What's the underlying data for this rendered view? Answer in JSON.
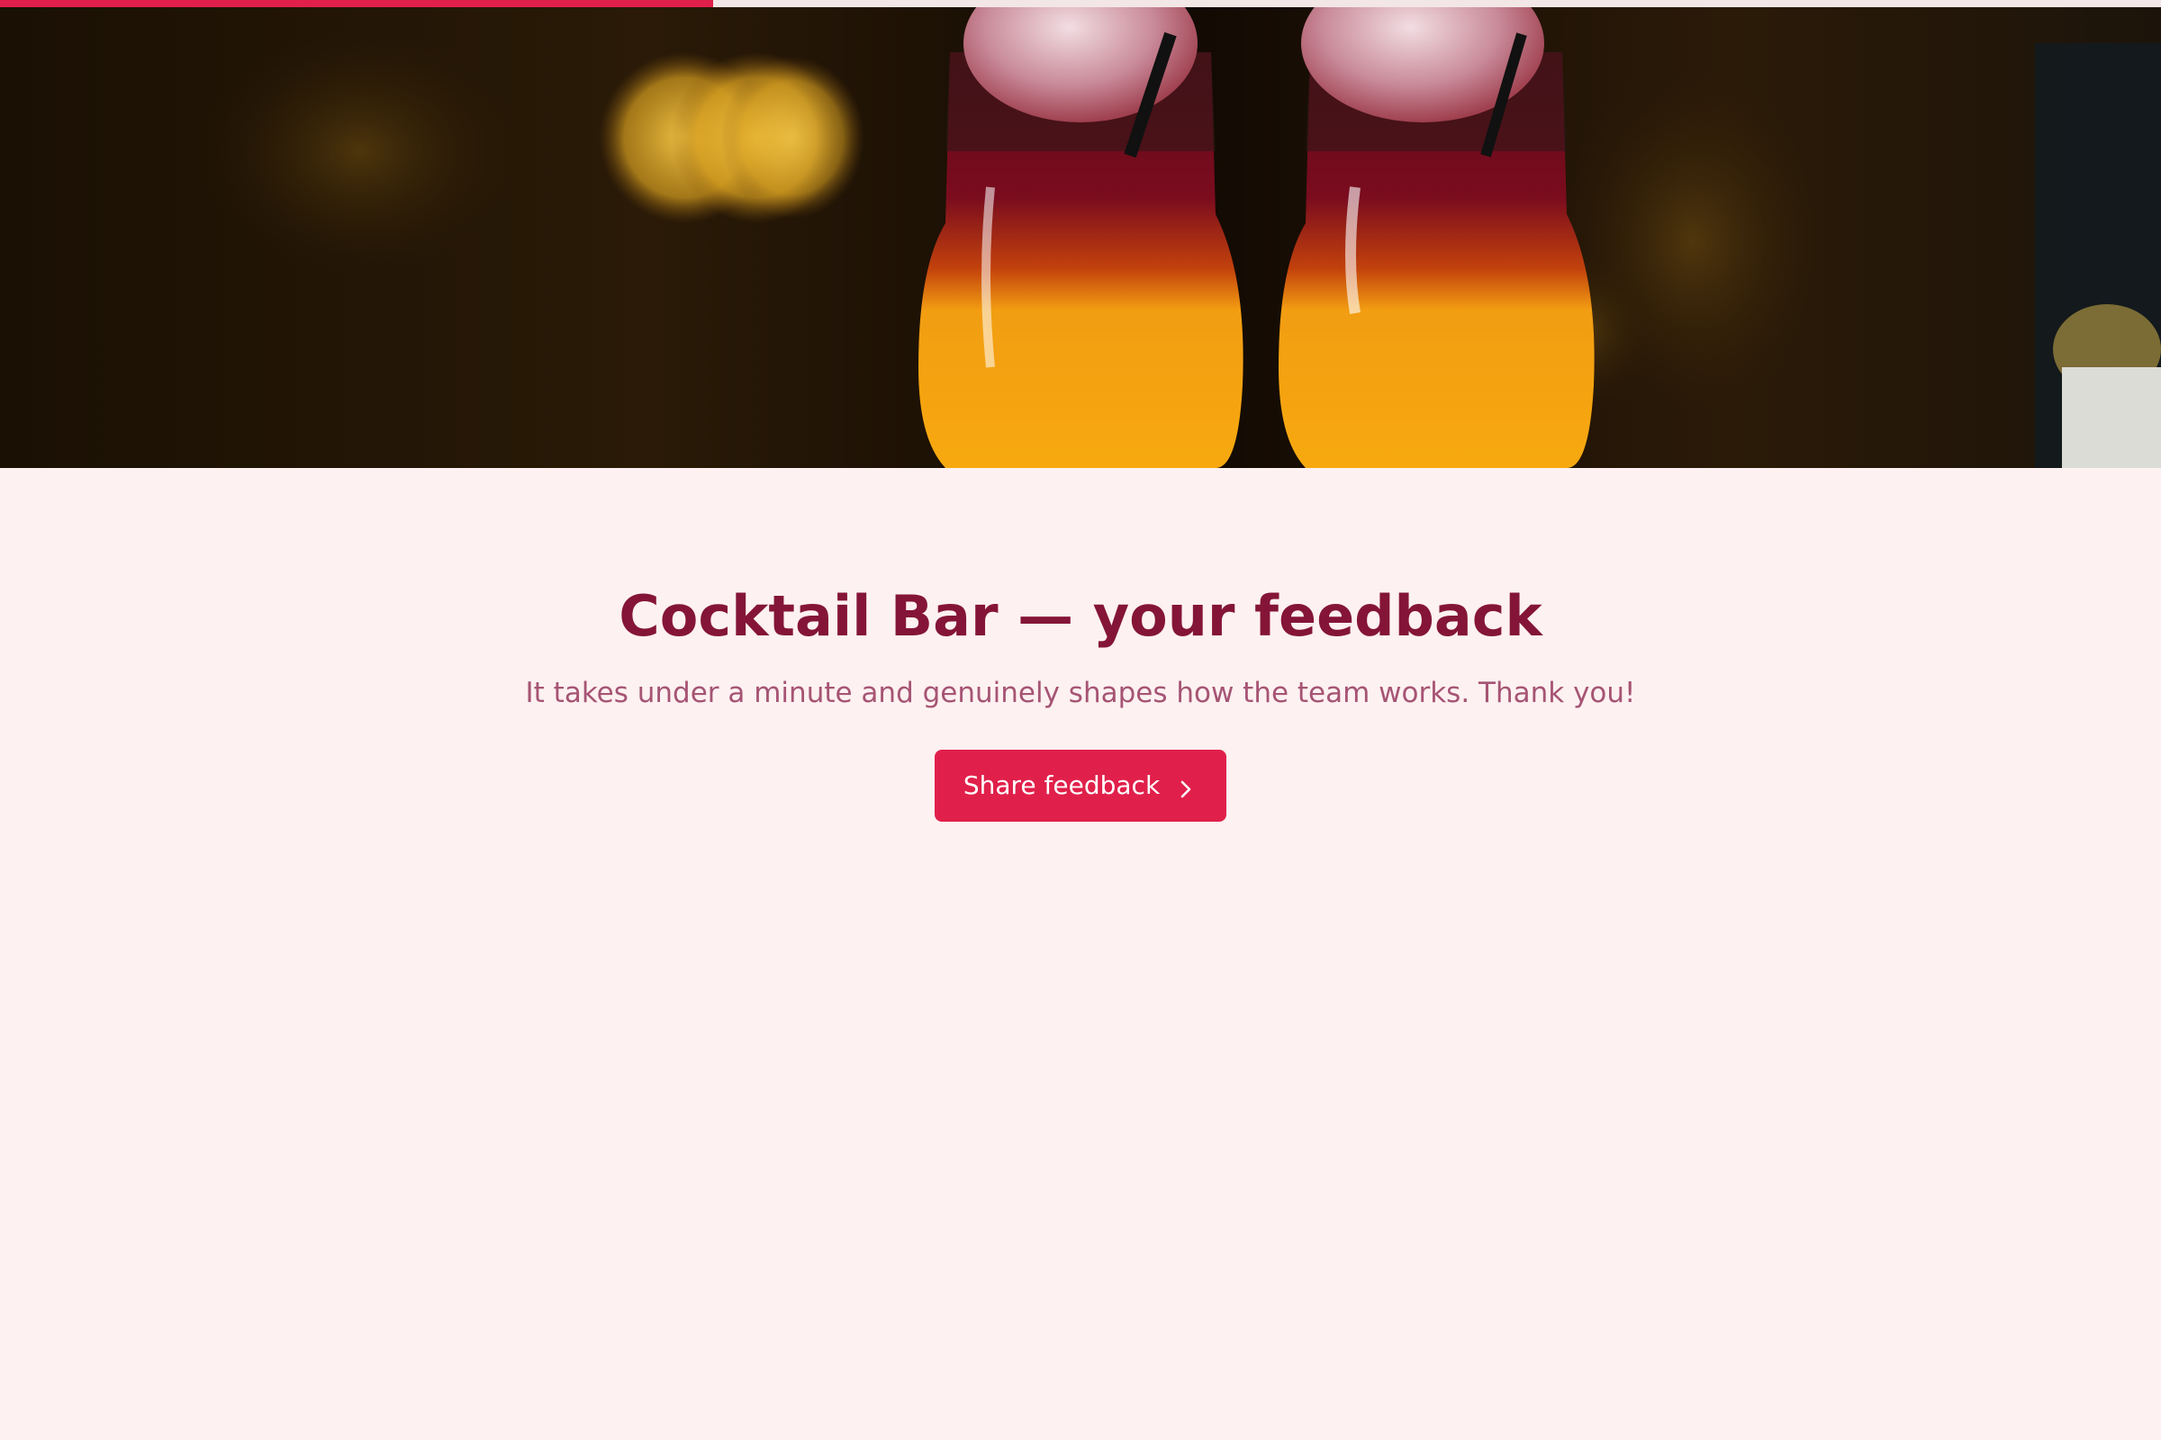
{
  "progress": {
    "fraction": 0.33
  },
  "hero": {
    "image": "cocktail-glasses-photo"
  },
  "main": {
    "title": "Cocktail Bar — your feedback",
    "subtitle": "It takes under a minute and genuinely shapes how the team works. Thank you!",
    "cta_label": "Share feedback",
    "cta_icon": "chevron-right-icon"
  },
  "colors": {
    "accent": "#e0204a",
    "title": "#841538",
    "subtitle": "#a65474",
    "background": "#fdf1f1"
  }
}
